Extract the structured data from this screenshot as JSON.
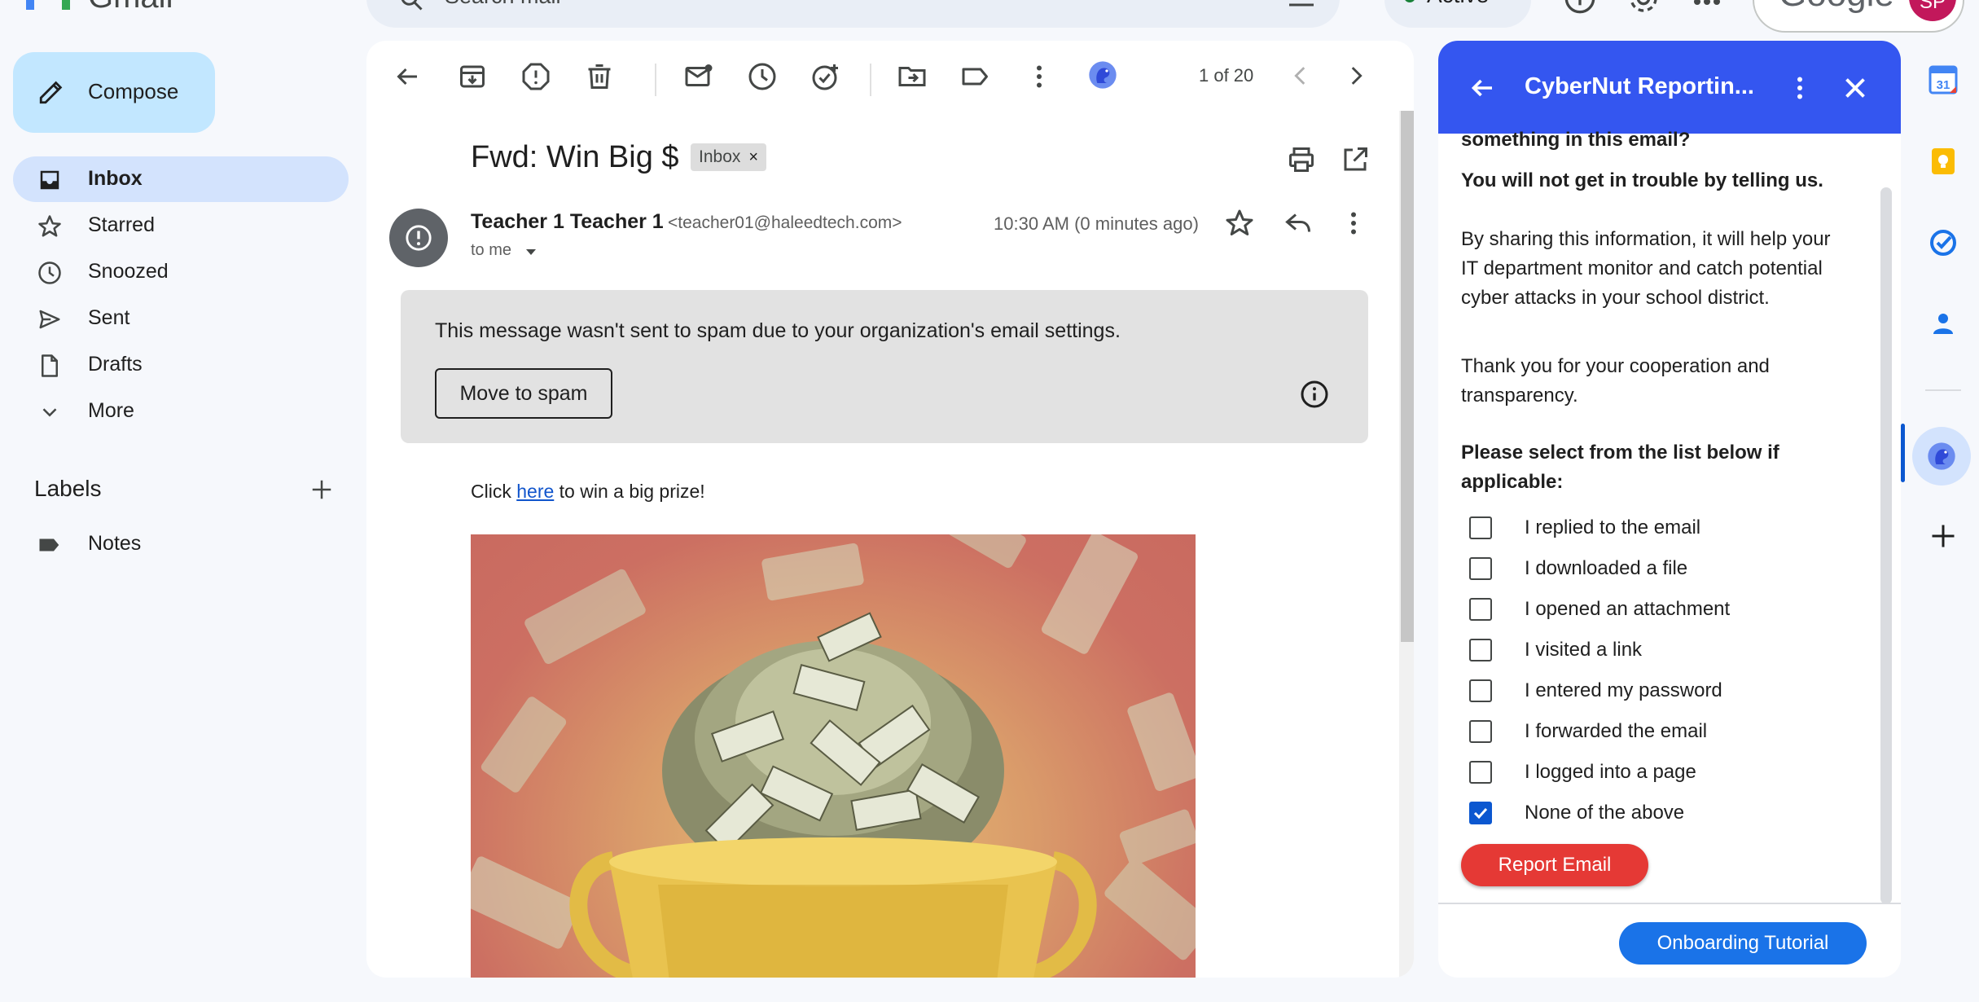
{
  "app": {
    "name": "Gmail",
    "account_brand": "Google",
    "account_initials": "SP"
  },
  "search": {
    "placeholder": "Search mail"
  },
  "status": {
    "label": "Active"
  },
  "nav": {
    "compose": "Compose",
    "items": [
      {
        "label": "Inbox",
        "icon": "inbox-icon",
        "active": true
      },
      {
        "label": "Starred",
        "icon": "star-icon"
      },
      {
        "label": "Snoozed",
        "icon": "clock-icon"
      },
      {
        "label": "Sent",
        "icon": "send-icon"
      },
      {
        "label": "Drafts",
        "icon": "draft-icon"
      },
      {
        "label": "More",
        "icon": "chevron-down-icon"
      }
    ],
    "labels_heading": "Labels",
    "labels": [
      {
        "label": "Notes",
        "icon": "label-icon"
      }
    ]
  },
  "toolbar": {
    "pager": "1 of 20"
  },
  "email": {
    "subject": "Fwd: Win Big $",
    "tag": "Inbox",
    "sender_name": "Teacher 1 Teacher 1",
    "sender_email": "<teacher01@haleedtech.com>",
    "recipient": "to me",
    "timestamp": "10:30 AM (0 minutes ago)",
    "spam_notice": "This message wasn't sent to spam due to your organization's email settings.",
    "spam_button": "Move to spam",
    "body_before": "Click ",
    "body_link": "here",
    "body_after": " to win a big prize!"
  },
  "panel": {
    "title": "CyberNut Reportin...",
    "question_tail": "something in this email?",
    "reassurance": "You will not get in trouble by telling us.",
    "info_lines": [
      "By sharing this information, it will help your",
      "IT department monitor and catch potential",
      "cyber attacks in your school district."
    ],
    "thanks_lines": [
      "Thank you for your cooperation and",
      "transparency."
    ],
    "select_lines": [
      "Please select from the list below if",
      "applicable:"
    ],
    "options": [
      {
        "label": "I replied to the email",
        "checked": false
      },
      {
        "label": "I downloaded a file",
        "checked": false
      },
      {
        "label": "I opened an attachment",
        "checked": false
      },
      {
        "label": "I visited a link",
        "checked": false
      },
      {
        "label": "I entered my password",
        "checked": false
      },
      {
        "label": "I forwarded the email",
        "checked": false
      },
      {
        "label": "I logged into a page",
        "checked": false
      },
      {
        "label": "None of the above",
        "checked": true
      }
    ],
    "report_button": "Report Email",
    "tutorial_button": "Onboarding Tutorial"
  },
  "rail": {
    "calendar_day": "31",
    "items": [
      "calendar-icon",
      "keep-icon",
      "tasks-icon",
      "contacts-icon",
      "cybernut-icon",
      "add-icon"
    ]
  },
  "colors": {
    "accent": "#0b57d0",
    "panel_header": "#3456f0",
    "report": "#e53935",
    "tutorial": "#1a73e8",
    "nav_active": "#d3e3fd",
    "compose": "#c2e7ff"
  }
}
